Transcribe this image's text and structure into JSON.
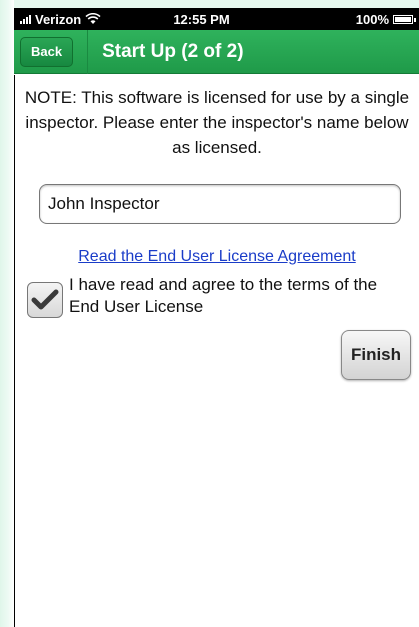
{
  "status_bar": {
    "carrier": "Verizon",
    "time": "12:55 PM",
    "battery": "100%"
  },
  "nav": {
    "back_label": "Back",
    "title": "Start Up (2 of 2)"
  },
  "content": {
    "note": "NOTE: This software is licensed for use by a single inspector. Please enter the inspector's name below as licensed.",
    "inspector_name": "John Inspector",
    "eula_link": "Read the End User License Agreement",
    "agree_text": "I have read and agree to the terms of the End User License",
    "agree_checked": true,
    "finish_label": "Finish"
  },
  "colors": {
    "nav_green": "#1f9a49",
    "link_blue": "#1a3cc8"
  }
}
